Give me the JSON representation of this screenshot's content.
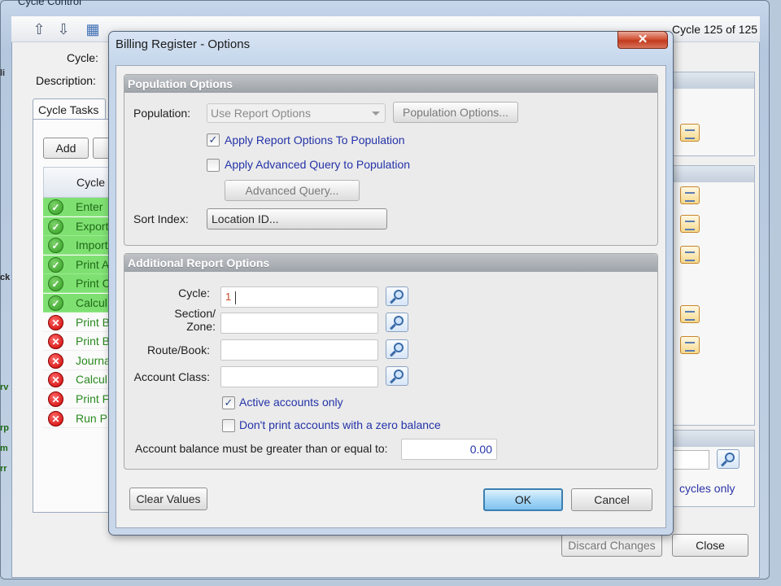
{
  "background_window": {
    "title": "Cycle Control",
    "cycle_counter": "Cycle 125 of 125",
    "cycle_label": "Cycle:",
    "description_label": "Description:",
    "tab_label": "Cycle Tasks",
    "add_button": "Add",
    "grid_header": "Cycle",
    "tasks": [
      {
        "label": "Enter",
        "status": "ok"
      },
      {
        "label": "Export",
        "status": "ok"
      },
      {
        "label": "Import",
        "status": "ok"
      },
      {
        "label": "Print A",
        "status": "ok"
      },
      {
        "label": "Print C",
        "status": "ok"
      },
      {
        "label": "Calcul",
        "status": "ok"
      },
      {
        "label": "Print B",
        "status": "error"
      },
      {
        "label": "Print B",
        "status": "error"
      },
      {
        "label": "Journa",
        "status": "error"
      },
      {
        "label": "Calcul",
        "status": "error"
      },
      {
        "label": "Print F",
        "status": "error"
      },
      {
        "label": "Run P",
        "status": "error"
      }
    ],
    "cycles_only_text": "cycles only",
    "discard_button": "Discard Changes",
    "close_button": "Close"
  },
  "dialog": {
    "title": "Billing Register -  Options",
    "close_glyph": "✕",
    "population_section": {
      "header": "Population Options",
      "population_label": "Population:",
      "population_value": "Use Report Options",
      "population_options_button": "Population Options...",
      "apply_report_options": {
        "label": "Apply Report Options To Population",
        "checked": true
      },
      "apply_advanced_query": {
        "label": "Apply Advanced Query to Population",
        "checked": false
      },
      "advanced_query_button": "Advanced Query...",
      "sort_index_label": "Sort Index:",
      "sort_index_value": "Location ID..."
    },
    "additional_section": {
      "header": "Additional Report Options",
      "cycle_label": "Cycle:",
      "cycle_value": "1",
      "section_zone_label_1": "Section/",
      "section_zone_label_2": "Zone:",
      "section_zone_value": "",
      "route_book_label": "Route/Book:",
      "route_book_value": "",
      "account_class_label": "Account Class:",
      "account_class_value": "",
      "active_accounts_only": {
        "label": "Active accounts only",
        "checked": true
      },
      "no_zero_balance": {
        "label": "Don't print accounts with a zero balance",
        "checked": false
      },
      "balance_label": "Account balance must be greater than or equal to:",
      "balance_value": "0.00"
    },
    "clear_values_button": "Clear Values",
    "ok_button": "OK",
    "cancel_button": "Cancel",
    "checkmark_glyph": "✓"
  },
  "colors": {
    "ok_row": "#7fe072",
    "error_icon": "#cc0000",
    "link_text": "#2433a8",
    "ok_button_accent": "#7fc1ef",
    "close_button": "#c23b1f"
  }
}
